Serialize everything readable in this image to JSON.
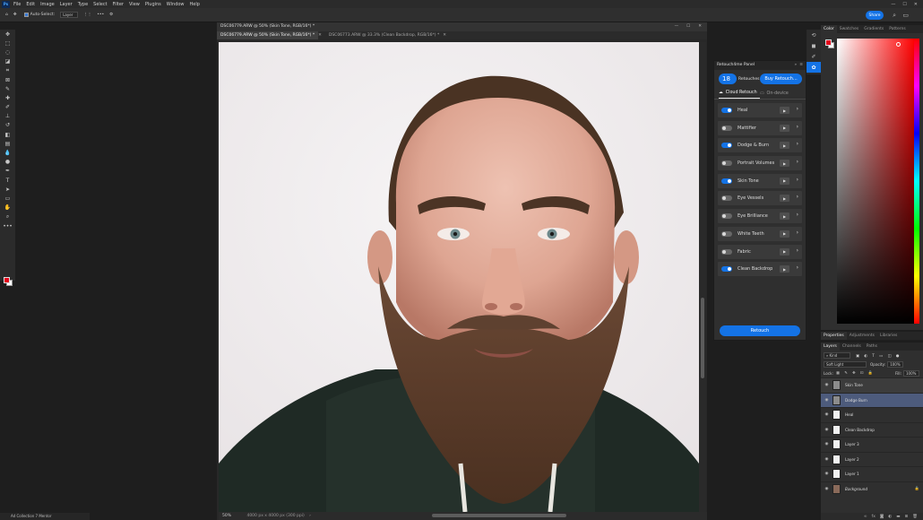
{
  "menubar": {
    "app_logo": "Ps",
    "items": [
      "File",
      "Edit",
      "Image",
      "Layer",
      "Type",
      "Select",
      "Filter",
      "View",
      "Plugins",
      "Window",
      "Help"
    ]
  },
  "options_bar": {
    "auto_select_label": "Auto-Select:",
    "auto_select_target": "Layer",
    "more_label": "•••",
    "share_label": "Share"
  },
  "document": {
    "title": "DSC06779.ARW @ 50% (Skin Tone, RGB/16*) *",
    "tabs": [
      {
        "label": "DSC06779.ARW @ 50% (Skin Tone, RGB/16*) *",
        "active": true
      },
      {
        "label": "DSC06773.ARW @ 33.3% (Clean Backdrop, RGB/16*) *",
        "active": false
      }
    ],
    "zoom": "50%",
    "doc_info": "4000 px x 4000 px (300 ppi)"
  },
  "retouch_panel": {
    "title": "Retouch4me Panel",
    "retouch_count": "18",
    "retouch_count_label": "Retouches",
    "buy_label": "Buy Retouch...",
    "tabs": [
      {
        "label": "Cloud Retouch",
        "active": true
      },
      {
        "label": "On-device",
        "active": false
      }
    ],
    "items": [
      {
        "label": "Heal",
        "enabled": true
      },
      {
        "label": "Mattifier",
        "enabled": false
      },
      {
        "label": "Dodge & Burn",
        "enabled": true
      },
      {
        "label": "Portrait Volumes",
        "enabled": false
      },
      {
        "label": "Skin Tone",
        "enabled": true
      },
      {
        "label": "Eye Vessels",
        "enabled": false
      },
      {
        "label": "Eye Brilliance",
        "enabled": false
      },
      {
        "label": "White Teeth",
        "enabled": false
      },
      {
        "label": "Fabric",
        "enabled": false
      },
      {
        "label": "Clean Backdrop",
        "enabled": true
      }
    ],
    "retouch_button": "Retouch"
  },
  "color_panel": {
    "tabs": [
      "Color",
      "Swatches",
      "Gradients",
      "Patterns"
    ],
    "foreground": "#e3001b",
    "background": "#ffffff"
  },
  "properties_tabs": [
    "Properties",
    "Adjustments",
    "Libraries"
  ],
  "layers_panel": {
    "tabs": [
      "Layers",
      "Channels",
      "Paths"
    ],
    "filter_kind": "Kind",
    "blend_mode": "Soft Light",
    "opacity_label": "Opacity:",
    "opacity_value": "100%",
    "lock_label": "Lock:",
    "fill_label": "Fill:",
    "fill_value": "100%",
    "layers": [
      {
        "name": "Skin Tone",
        "selected": false,
        "highlight": true
      },
      {
        "name": "Dodge Burn",
        "selected": true,
        "highlight": false
      },
      {
        "name": "Heal",
        "selected": false,
        "highlight": false
      },
      {
        "name": "Clean Backdrop",
        "selected": false,
        "highlight": false
      },
      {
        "name": "Layer 3",
        "selected": false,
        "highlight": false
      },
      {
        "name": "Layer 2",
        "selected": false,
        "highlight": false
      },
      {
        "name": "Layer 1",
        "selected": false,
        "highlight": false
      },
      {
        "name": "Background",
        "selected": false,
        "highlight": false
      }
    ]
  },
  "libraries_tab": "Ad Collection 7 Mentor"
}
